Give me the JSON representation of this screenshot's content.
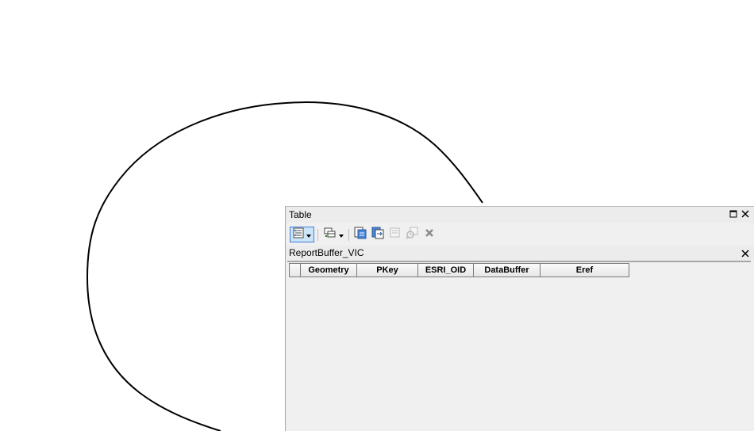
{
  "window": {
    "title": "Table"
  },
  "toolbar": {
    "buttons": [
      {
        "icon": "table-options-icon",
        "active": true,
        "has_dropdown": true
      },
      {
        "icon": "related-tables-icon",
        "has_dropdown": true
      },
      {
        "icon": "select-by-attributes-icon"
      },
      {
        "icon": "switch-selection-icon"
      },
      {
        "icon": "clear-selection-icon",
        "enabled": false
      },
      {
        "icon": "zoom-to-selected-icon",
        "enabled": false
      },
      {
        "icon": "delete-selected-icon",
        "enabled": false
      }
    ]
  },
  "tab": {
    "label": "ReportBuffer_VIC"
  },
  "grid": {
    "columns": [
      "Geometry",
      "PKey",
      "ESRI_OID",
      "DataBuffer",
      "Eref"
    ],
    "rows": []
  },
  "colors": {
    "window_bg": "#f0f0f0",
    "selected_tool": "#cce4f7",
    "selected_border": "#3d7ed9"
  }
}
